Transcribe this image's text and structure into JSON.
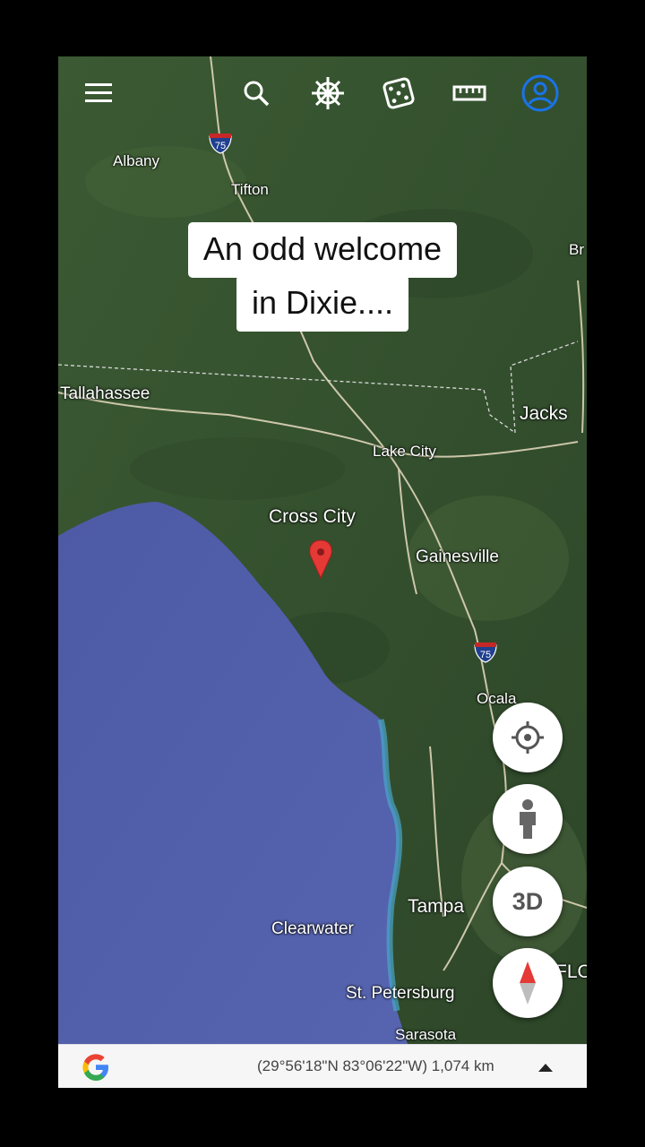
{
  "caption": {
    "line1": "An odd welcome",
    "line2": "in Dixie...."
  },
  "toolbar": {
    "icons": [
      "menu-icon",
      "search-icon",
      "voyager-wheel-icon",
      "dice-icon",
      "ruler-icon",
      "account-icon"
    ],
    "accent_color": "#1a73e8"
  },
  "map": {
    "places": {
      "albany": "Albany",
      "tifton": "Tifton",
      "tallahassee": "Tallahassee",
      "jacksonville_partial": "Jacks",
      "brunswick_partial": "Br",
      "lake_city": "Lake City",
      "cross_city": "Cross City",
      "gainesville": "Gainesville",
      "ocala": "Ocala",
      "tampa": "Tampa",
      "clearwater": "Clearwater",
      "st_petersburg": "St. Petersburg",
      "sarasota": "Sarasota",
      "florida_partial": "FLO"
    },
    "interstate_shields": [
      "75",
      "75"
    ],
    "marker": {
      "place": "Cross City",
      "color": "#e53935"
    }
  },
  "controls": {
    "locate": "my-location-icon",
    "pegman": "pegman-icon",
    "btn3d": "3D",
    "compass": "compass-icon"
  },
  "status": {
    "coordinates": "(29°56'18\"N 83°06'22\"W) 1,074 km",
    "logo": "google-g-icon"
  }
}
